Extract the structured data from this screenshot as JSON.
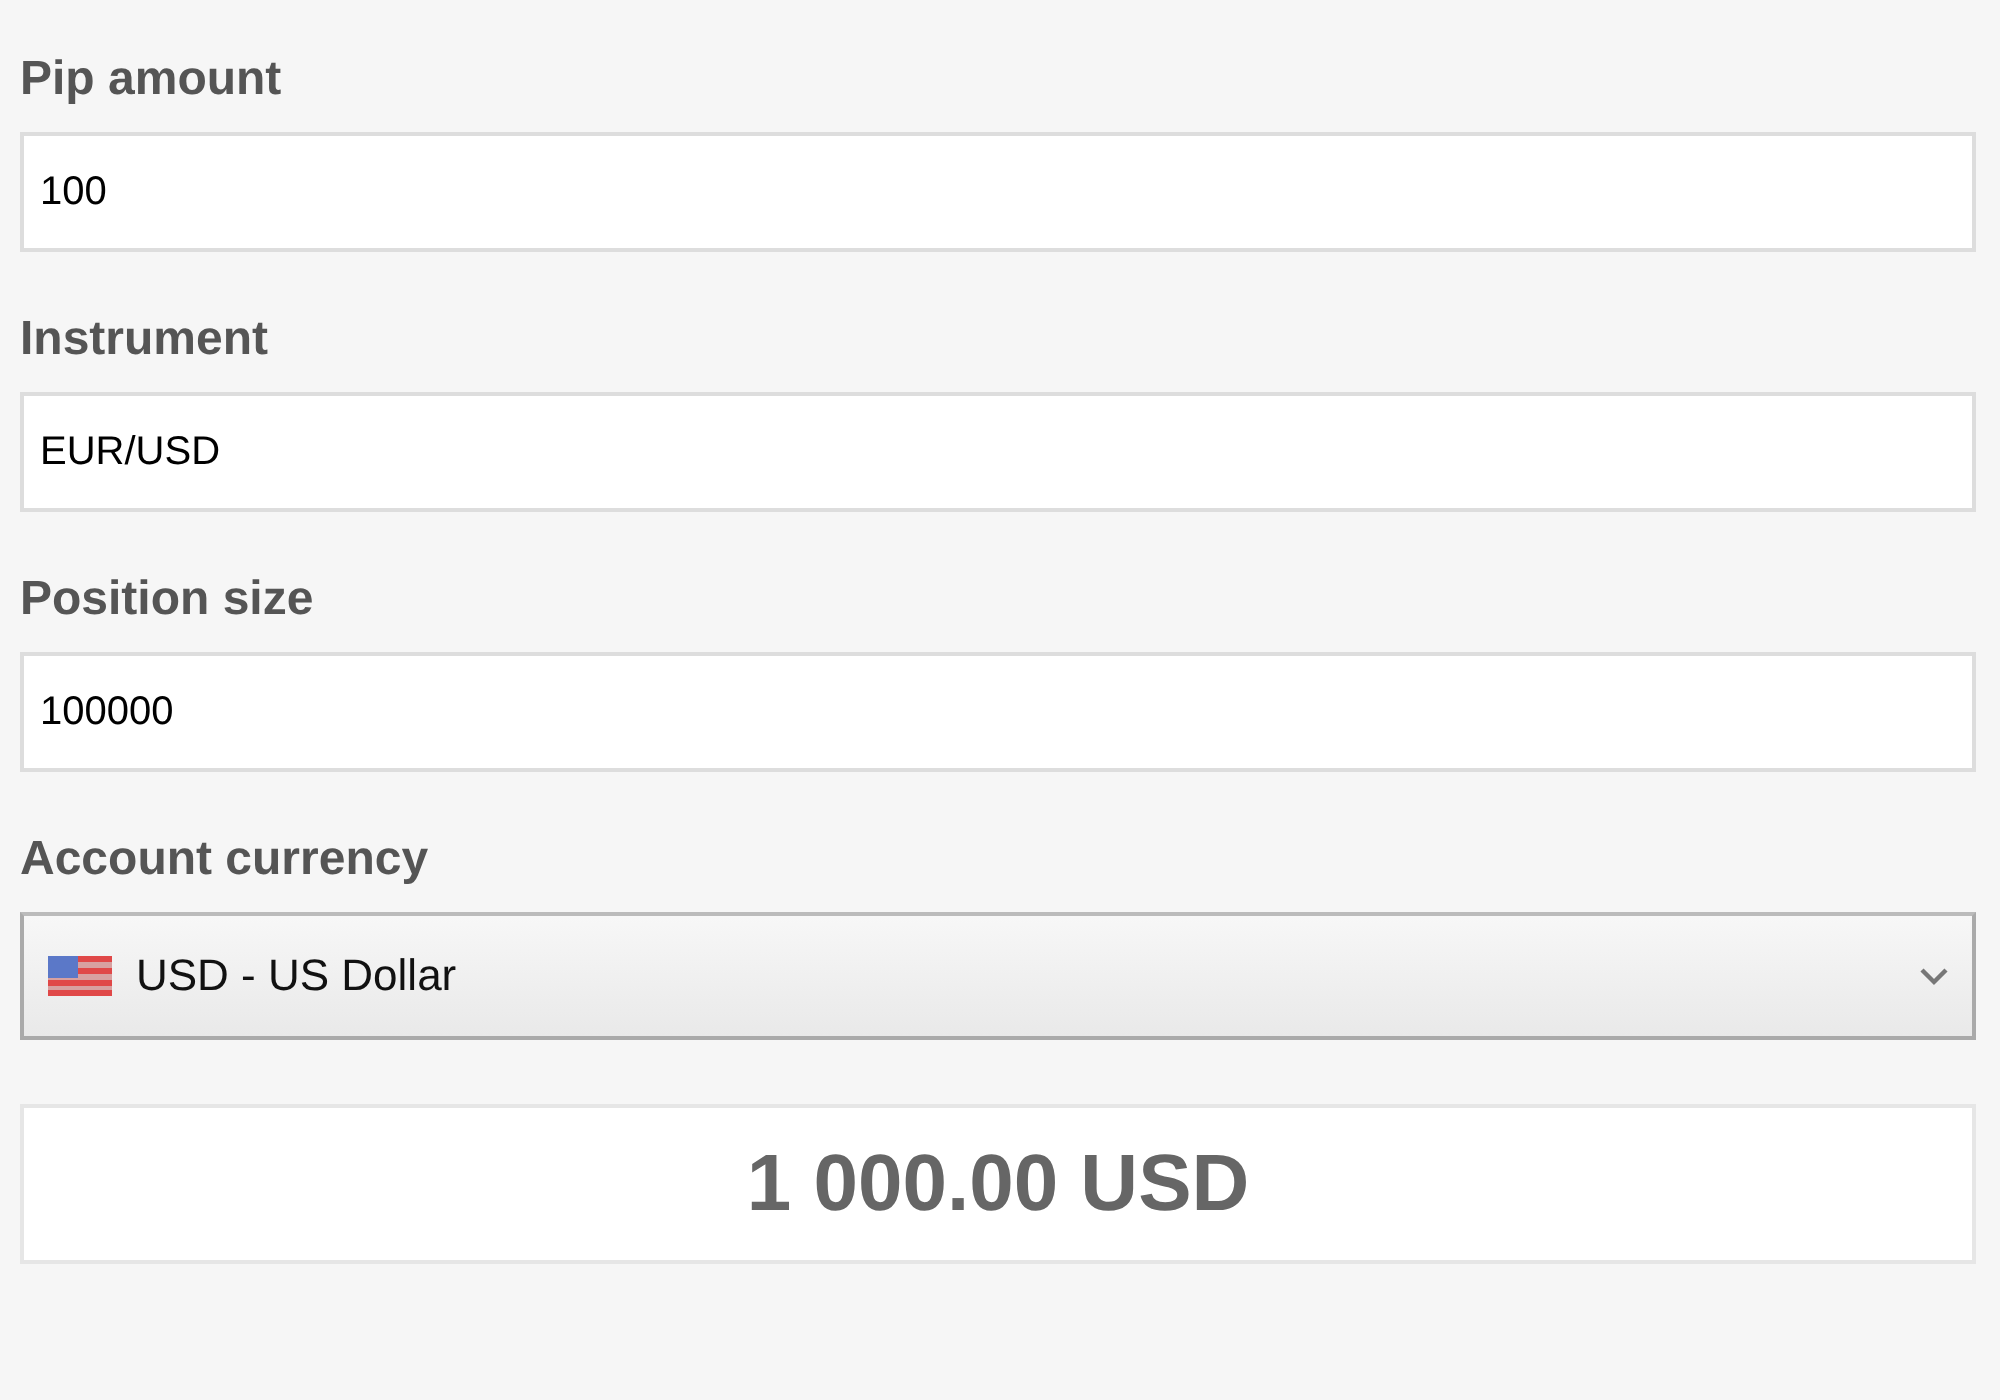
{
  "fields": [
    {
      "kind": "text",
      "label": "Pip amount",
      "value": "100"
    },
    {
      "kind": "text",
      "label": "Instrument",
      "value": "EUR/USD"
    },
    {
      "kind": "text",
      "label": "Position size",
      "value": "100000"
    },
    {
      "kind": "select",
      "label": "Account currency",
      "value": "USD - US Dollar"
    }
  ],
  "result": "1 000.00 USD"
}
